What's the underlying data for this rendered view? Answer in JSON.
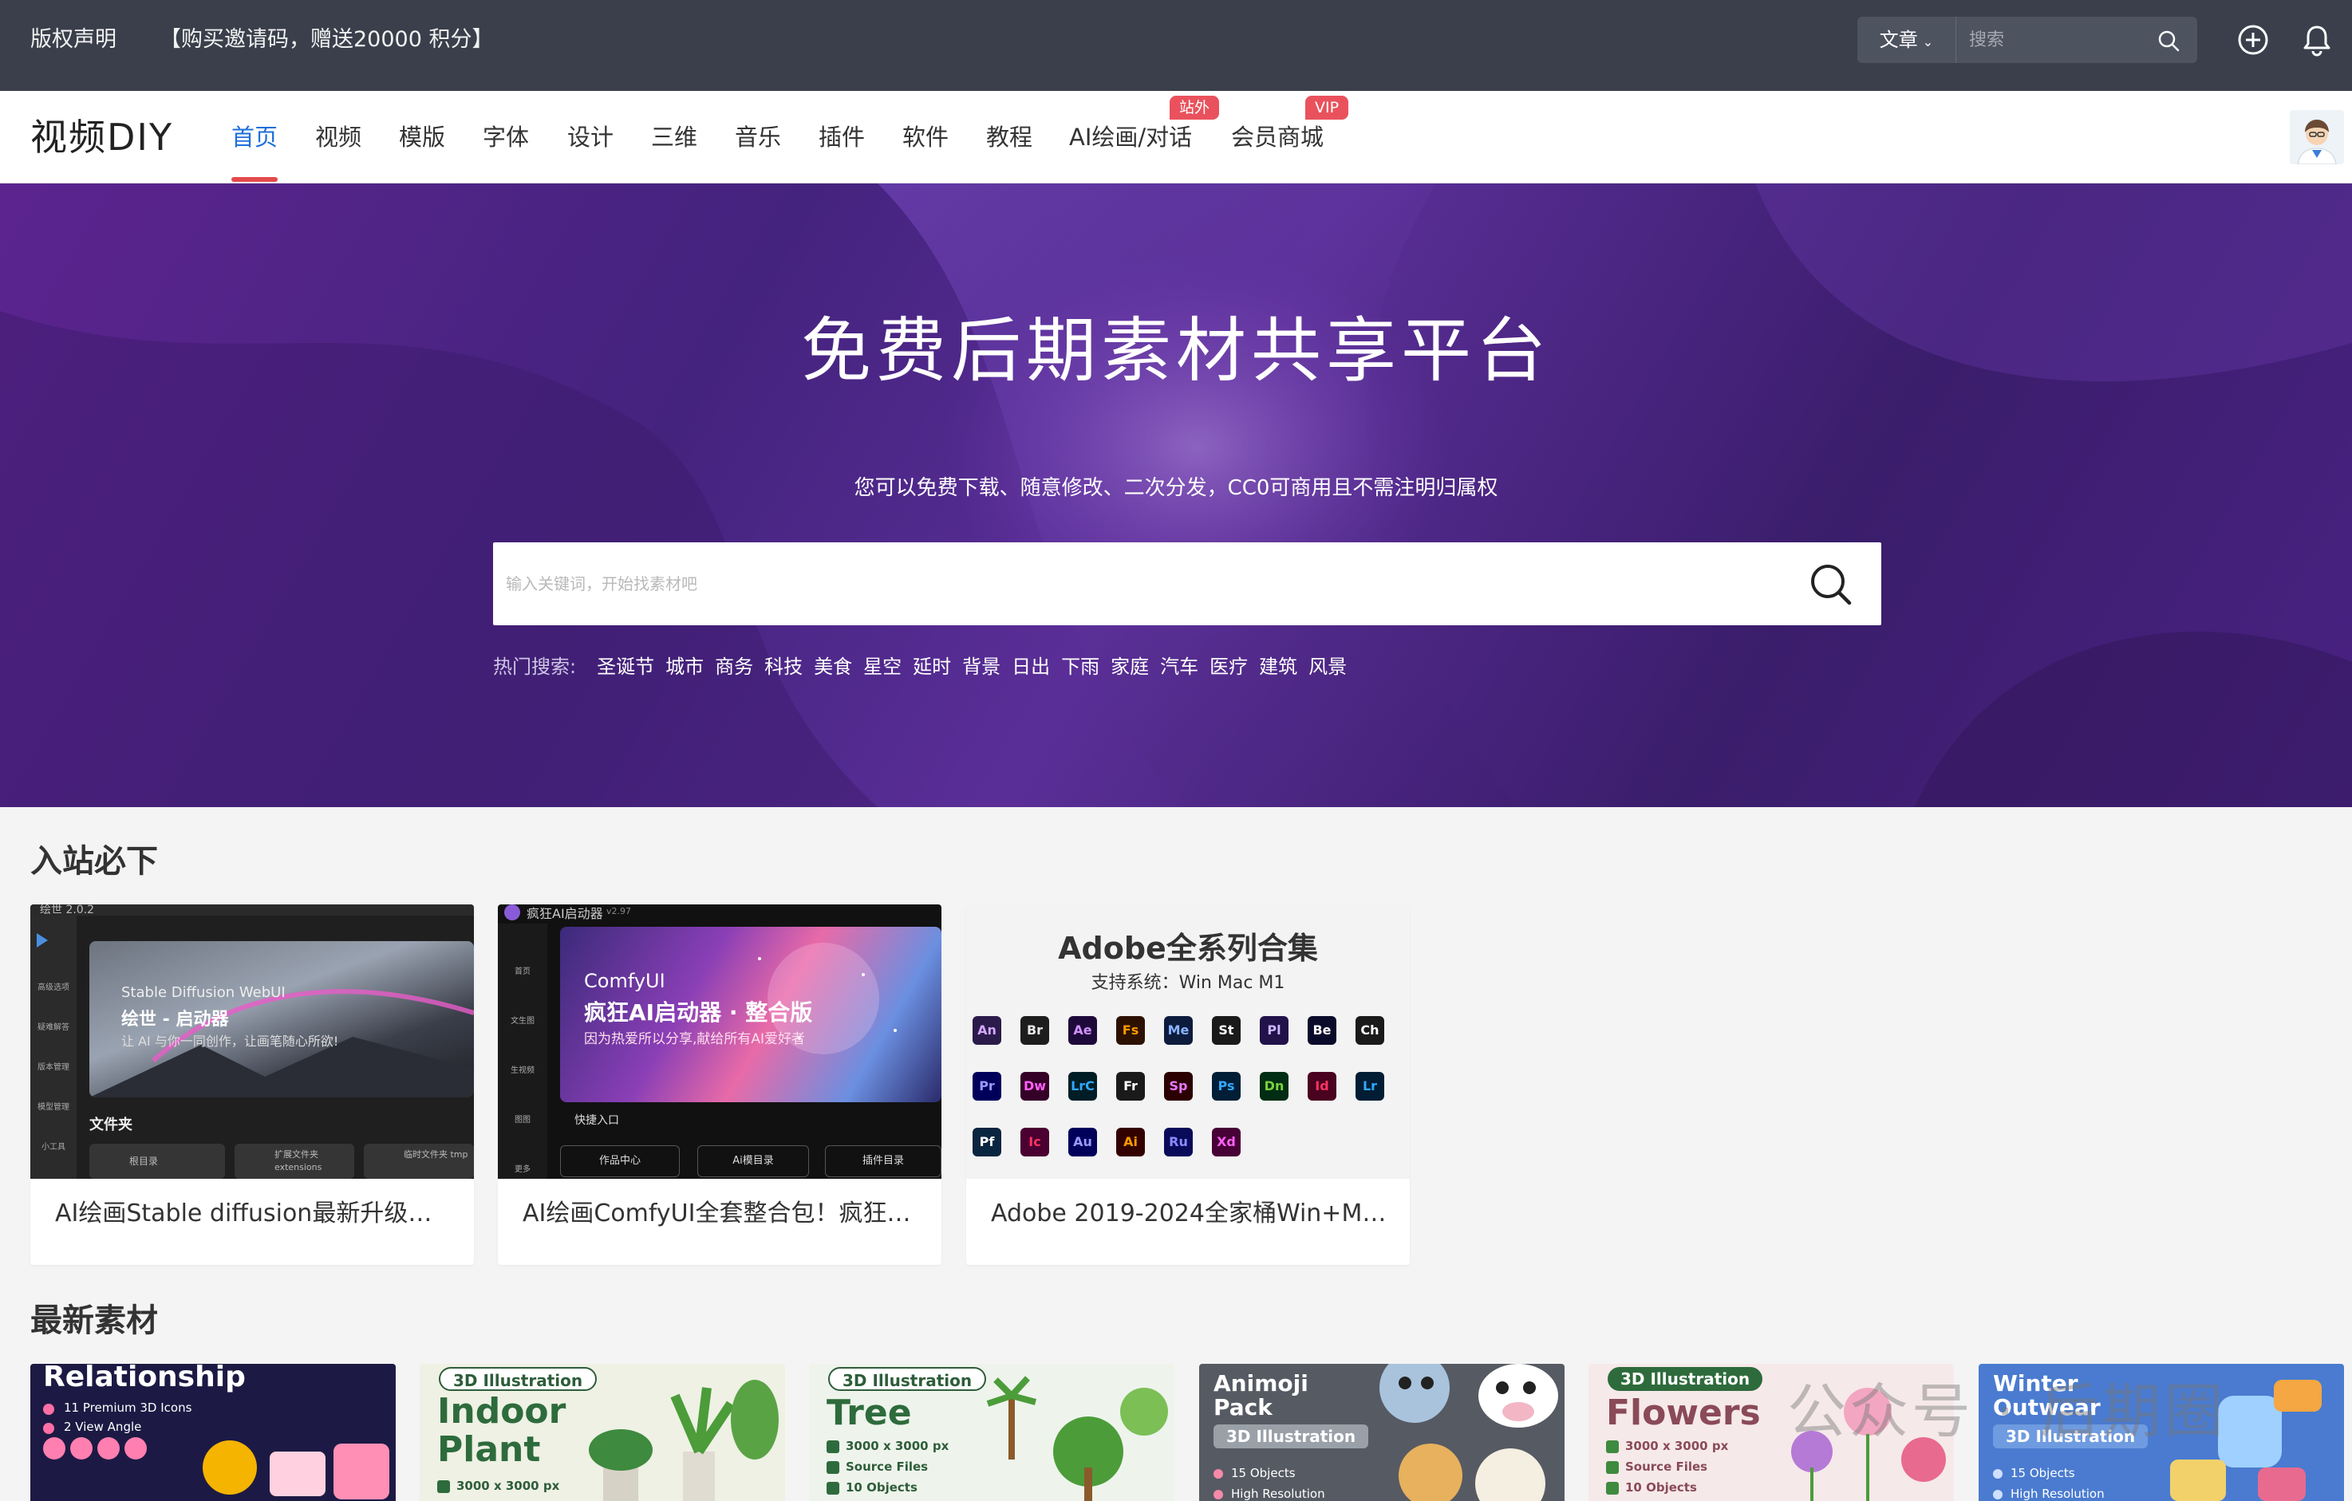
{
  "topbar": {
    "left_links": [
      "版权声明",
      "【购买邀请码，赠送20000 积分】"
    ],
    "search_category": "文章",
    "search_placeholder": "搜索"
  },
  "nav": {
    "logo": "视频DIY",
    "items": [
      "首页",
      "视频",
      "模版",
      "字体",
      "设计",
      "三维",
      "音乐",
      "插件",
      "软件",
      "教程",
      "AI绘画/对话",
      "会员商城"
    ],
    "badges": {
      "ai": "站外",
      "vip": "VIP"
    }
  },
  "hero": {
    "title": "免费后期素材共享平台",
    "subtitle": "您可以免费下载、随意修改、二次分发，CC0可商用且不需注明归属权",
    "search_placeholder": "输入关键词，开始找素材吧",
    "hot_label": "热门搜索:",
    "hot_keywords": [
      "圣诞节",
      "城市",
      "商务",
      "科技",
      "美食",
      "星空",
      "延时",
      "背景",
      "日出",
      "下雨",
      "家庭",
      "汽车",
      "医疗",
      "建筑",
      "风景"
    ]
  },
  "section_must": {
    "title": "入站必下",
    "cards": [
      {
        "title": "AI绘画Stable diffusion最新升级…",
        "thumb": {
          "version": "绘世 2.0.2",
          "app_name": "Stable Diffusion WebUI",
          "headline": "绘世 - 启动器",
          "tagline": "让 AI 与你一同创作，让画笔随心所欲!",
          "side_items": [
            "高级选项",
            "疑难解答",
            "版本管理",
            "模型管理",
            "小工具"
          ],
          "folder_label": "文件夹",
          "folder_buttons": [
            "根目录",
            "扩展文件夹 extensions",
            "临时文件夹 tmp"
          ]
        }
      },
      {
        "title": "AI绘画ComfyUI全套整合包！疯狂…",
        "thumb": {
          "app_name": "疯狂AI启动器",
          "version": "v2.97",
          "product": "ComfyUI",
          "headline": "疯狂AI启动器 · 整合版",
          "tagline": "因为热爱所以分享,献给所有AI爱好者",
          "side_items": [
            "首页",
            "文生图",
            "生视频",
            "图图",
            "更多"
          ],
          "quick": "快捷入口",
          "buttons": [
            "作品中心",
            "Ai模目录",
            "插件目录"
          ]
        }
      },
      {
        "title": "Adobe 2019-2024全家桶Win+M…",
        "thumb": {
          "headline": "Adobe全系列合集",
          "support": "支持系统：Win Mac M1",
          "apps": [
            "An",
            "Br",
            "Ae",
            "Fs",
            "Me",
            "St",
            "Pl",
            "Be",
            "Ch",
            "Pr",
            "Dw",
            "LrC",
            "Fr",
            "Sp",
            "Ps",
            "Dn",
            "Id",
            "Lr",
            "Pf",
            "Ic",
            "Au",
            "Ai",
            "Ru",
            "Xd"
          ]
        }
      }
    ]
  },
  "section_latest": {
    "title": "最新素材",
    "tiles": [
      {
        "title": "Relationship",
        "lines": [
          "11 Premium 3D Icons",
          "2 View Angle"
        ]
      },
      {
        "pill": "3D Illustration",
        "title": "Indoor Plant",
        "lines": [
          "3000 x 3000 px"
        ]
      },
      {
        "pill": "3D Illustration",
        "title": "Tree",
        "lines": [
          "3000 x 3000 px",
          "Source Files",
          "10 Objects"
        ]
      },
      {
        "title": "Animoji Pack",
        "pill": "3D Illustration",
        "lines": [
          "15 Objects",
          "High Resolution"
        ]
      },
      {
        "pill": "3D Illustration",
        "title": "Flowers",
        "lines": [
          "3000 x 3000 px",
          "Source Files",
          "10 Objects"
        ]
      },
      {
        "title": "Winter Outwear",
        "pill": "3D Illustration",
        "lines": [
          "15 Objects",
          "High Resolution"
        ]
      }
    ]
  },
  "watermark": "公众号 · 后期圈",
  "colors": {
    "topbar": "#3a3f4b",
    "active_nav": "#1e6fd9",
    "badge": "#e9525d",
    "hero": "#4a2283"
  }
}
